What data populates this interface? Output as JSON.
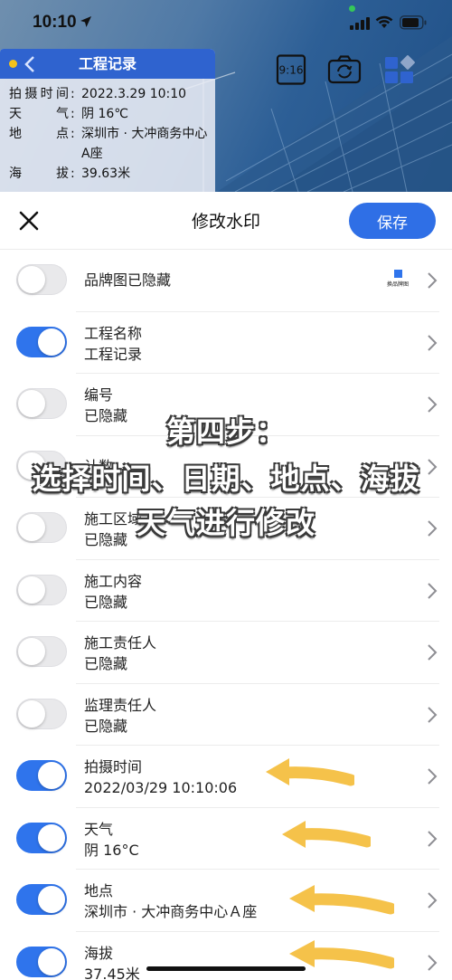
{
  "status_bar": {
    "time": "10:10"
  },
  "watermark": {
    "title": "工程记录",
    "rows": [
      {
        "key": [
          "拍",
          "摄",
          "时",
          "间"
        ],
        "value": "2022.3.29 10:10"
      },
      {
        "key": [
          "天",
          "气"
        ],
        "value": "阴 16℃"
      },
      {
        "key": [
          "地",
          "点"
        ],
        "value": "深圳市 · 大冲商务中心A座"
      },
      {
        "key": [
          "海",
          "拔"
        ],
        "value": "39.63米"
      }
    ]
  },
  "toolbar": {
    "ratio_label": "9:16"
  },
  "sheet": {
    "title": "修改水印",
    "save_label": "保存"
  },
  "items": [
    {
      "name": "品牌图已隐藏",
      "value": "",
      "enabled": false,
      "badge": "换品牌图"
    },
    {
      "name": "工程名称",
      "value": "工程记录",
      "enabled": true
    },
    {
      "name": "编号",
      "value": "已隐藏",
      "enabled": false
    },
    {
      "name": "计数",
      "value": "",
      "enabled": false
    },
    {
      "name": "施工区域",
      "value": "已隐藏",
      "enabled": false
    },
    {
      "name": "施工内容",
      "value": "已隐藏",
      "enabled": false
    },
    {
      "name": "施工责任人",
      "value": "已隐藏",
      "enabled": false
    },
    {
      "name": "监理责任人",
      "value": "已隐藏",
      "enabled": false
    },
    {
      "name": "拍摄时间",
      "value": "2022/03/29 10:10:06",
      "enabled": true
    },
    {
      "name": "天气",
      "value": "阴 16°C",
      "enabled": true
    },
    {
      "name": "地点",
      "value": "深圳市 · 大冲商务中心Ａ座",
      "enabled": true
    },
    {
      "name": "海拔",
      "value": "37.45米",
      "enabled": true
    }
  ],
  "annotation": {
    "line1": "第四步：",
    "line2": "选择时间、日期、地点、海拔",
    "line3": "天气进行修改",
    "arrow_color": "#f5c24a"
  },
  "colors": {
    "accent": "#2f74ec",
    "watermark_header": "#2f63cf"
  }
}
